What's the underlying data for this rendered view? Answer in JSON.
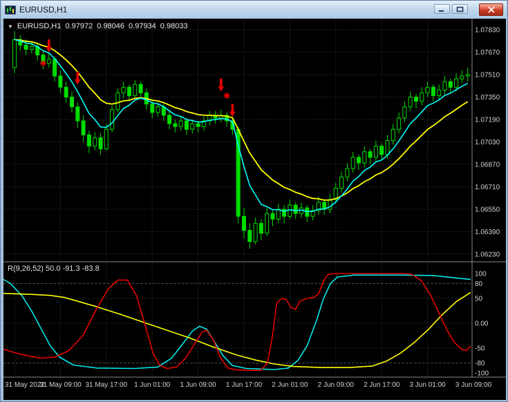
{
  "window": {
    "title": "EURUSD,H1"
  },
  "chart_data": {
    "type": "candlestick",
    "title": "EURUSD,H1",
    "info": {
      "marker": "▼",
      "symbol": "EURUSD,H1",
      "open": "0.97972",
      "high": "0.98046",
      "low": "0.97934",
      "close": "0.98033"
    },
    "price_axis": [
      "1.07830",
      "1.07670",
      "1.07510",
      "1.07350",
      "1.07190",
      "1.07030",
      "1.06870",
      "1.06710",
      "1.06550",
      "1.06390",
      "1.06230"
    ],
    "time_axis": [
      "31 May 2022",
      "31 May 09:00",
      "31 May 17:00",
      "1 Jun 01:00",
      "1 Jun 09:00",
      "1 Jun 17:00",
      "2 Jun 01:00",
      "2 Jun 09:00",
      "2 Jun 17:00",
      "3 Jun 01:00",
      "3 Jun 09:00"
    ],
    "ylim": [
      1.0618,
      1.079
    ],
    "ind_ylim": [
      -100,
      100
    ],
    "colors": {
      "background": "#000000",
      "grid": "#3a3a3a",
      "candle": "#00dd00",
      "ma_fast": "#00ffff",
      "ma_slow": "#ffff00",
      "signal": "#e60000",
      "axis_text": "#d2d2d2",
      "divider": "#8a8a8a",
      "ind_red": "#e60000",
      "ind_cyan": "#00e8e8",
      "ind_yellow": "#ffff00"
    },
    "ma_fast_period": 7,
    "ma_slow_period": 16,
    "candles": [
      [
        1.0756,
        1.0782,
        1.0752,
        1.0776
      ],
      [
        1.0776,
        1.0779,
        1.0768,
        1.0772
      ],
      [
        1.0772,
        1.0776,
        1.0765,
        1.0769
      ],
      [
        1.0769,
        1.0775,
        1.0766,
        1.0771
      ],
      [
        1.0771,
        1.0773,
        1.0761,
        1.0765
      ],
      [
        1.0765,
        1.0768,
        1.0755,
        1.0759
      ],
      [
        1.0759,
        1.0766,
        1.0756,
        1.0762
      ],
      [
        1.0762,
        1.0764,
        1.0746,
        1.075
      ],
      [
        1.075,
        1.0754,
        1.0738,
        1.0742
      ],
      [
        1.0742,
        1.0746,
        1.0731,
        1.0735
      ],
      [
        1.0735,
        1.0739,
        1.0724,
        1.0728
      ],
      [
        1.0728,
        1.0731,
        1.0713,
        1.0718
      ],
      [
        1.0718,
        1.0722,
        1.0703,
        1.0708
      ],
      [
        1.0708,
        1.0711,
        1.0695,
        1.07
      ],
      [
        1.07,
        1.071,
        1.0697,
        1.0706
      ],
      [
        1.0706,
        1.0709,
        1.0694,
        1.0698
      ],
      [
        1.0698,
        1.0716,
        1.0697,
        1.0712
      ],
      [
        1.0712,
        1.0729,
        1.071,
        1.0726
      ],
      [
        1.0726,
        1.0741,
        1.0724,
        1.0738
      ],
      [
        1.0738,
        1.0746,
        1.0734,
        1.0742
      ],
      [
        1.0742,
        1.0744,
        1.0732,
        1.0736
      ],
      [
        1.0736,
        1.0747,
        1.0734,
        1.0744
      ],
      [
        1.0744,
        1.0746,
        1.0734,
        1.0738
      ],
      [
        1.0738,
        1.0741,
        1.0726,
        1.073
      ],
      [
        1.073,
        1.0733,
        1.072,
        1.0724
      ],
      [
        1.0724,
        1.0731,
        1.0721,
        1.0728
      ],
      [
        1.0728,
        1.073,
        1.0718,
        1.0722
      ],
      [
        1.0722,
        1.0725,
        1.0712,
        1.0716
      ],
      [
        1.0716,
        1.0719,
        1.071,
        1.0714
      ],
      [
        1.0714,
        1.0721,
        1.0711,
        1.0718
      ],
      [
        1.0718,
        1.072,
        1.0708,
        1.0712
      ],
      [
        1.0712,
        1.0719,
        1.0709,
        1.0716
      ],
      [
        1.0716,
        1.0718,
        1.071,
        1.0714
      ],
      [
        1.0714,
        1.0721,
        1.0711,
        1.0718
      ],
      [
        1.0718,
        1.0725,
        1.0715,
        1.0722
      ],
      [
        1.0722,
        1.0725,
        1.0716,
        1.072
      ],
      [
        1.072,
        1.0726,
        1.0717,
        1.0722
      ],
      [
        1.0722,
        1.0724,
        1.0714,
        1.0718
      ],
      [
        1.0718,
        1.072,
        1.0708,
        1.0712
      ],
      [
        1.0712,
        1.0714,
        1.0645,
        1.065
      ],
      [
        1.065,
        1.0656,
        1.0634,
        1.064
      ],
      [
        1.064,
        1.0645,
        1.0627,
        1.0632
      ],
      [
        1.0632,
        1.0649,
        1.063,
        1.0645
      ],
      [
        1.0645,
        1.0648,
        1.0633,
        1.0638
      ],
      [
        1.0638,
        1.0656,
        1.0636,
        1.0652
      ],
      [
        1.0652,
        1.0655,
        1.0643,
        1.0648
      ],
      [
        1.0648,
        1.0659,
        1.0645,
        1.0655
      ],
      [
        1.0655,
        1.0658,
        1.0645,
        1.065
      ],
      [
        1.065,
        1.0662,
        1.0648,
        1.0658
      ],
      [
        1.0658,
        1.066,
        1.0648,
        1.0652
      ],
      [
        1.0652,
        1.066,
        1.0649,
        1.0656
      ],
      [
        1.0656,
        1.0658,
        1.0646,
        1.065
      ],
      [
        1.065,
        1.0658,
        1.0647,
        1.0654
      ],
      [
        1.0654,
        1.0664,
        1.0651,
        1.066
      ],
      [
        1.066,
        1.0662,
        1.0651,
        1.0655
      ],
      [
        1.0655,
        1.0666,
        1.0652,
        1.0662
      ],
      [
        1.0662,
        1.0674,
        1.0659,
        1.067
      ],
      [
        1.067,
        1.0682,
        1.0667,
        1.0678
      ],
      [
        1.0678,
        1.0688,
        1.0675,
        1.0684
      ],
      [
        1.0684,
        1.0696,
        1.0681,
        1.0692
      ],
      [
        1.0692,
        1.0694,
        1.0683,
        1.0688
      ],
      [
        1.0688,
        1.07,
        1.0685,
        1.0696
      ],
      [
        1.0696,
        1.0698,
        1.0687,
        1.0692
      ],
      [
        1.0692,
        1.0704,
        1.0689,
        1.07
      ],
      [
        1.07,
        1.0702,
        1.069,
        1.0694
      ],
      [
        1.0694,
        1.0708,
        1.0691,
        1.0704
      ],
      [
        1.0704,
        1.0716,
        1.0701,
        1.0712
      ],
      [
        1.0712,
        1.0724,
        1.0709,
        1.072
      ],
      [
        1.072,
        1.0732,
        1.0717,
        1.0728
      ],
      [
        1.0728,
        1.0739,
        1.0725,
        1.0735
      ],
      [
        1.0735,
        1.0737,
        1.0727,
        1.0732
      ],
      [
        1.0732,
        1.0742,
        1.0729,
        1.0738
      ],
      [
        1.0738,
        1.0746,
        1.0735,
        1.0742
      ],
      [
        1.0742,
        1.0744,
        1.0732,
        1.0736
      ],
      [
        1.0736,
        1.0744,
        1.0733,
        1.074
      ],
      [
        1.074,
        1.075,
        1.0737,
        1.0746
      ],
      [
        1.0746,
        1.0748,
        1.0738,
        1.0742
      ],
      [
        1.0742,
        1.0752,
        1.0739,
        1.0748
      ],
      [
        1.0748,
        1.0754,
        1.0745,
        1.075
      ],
      [
        1.075,
        1.0756,
        1.0746,
        1.0751
      ]
    ],
    "signals": {
      "arrows": [
        {
          "bar": 6,
          "price": 1.0767
        },
        {
          "bar": 11,
          "price": 1.0744
        },
        {
          "bar": 36,
          "price": 1.0739
        },
        {
          "bar": 38,
          "price": 1.0721
        }
      ],
      "stars": [
        {
          "bar": 5,
          "price": 1.0759
        },
        {
          "bar": 37,
          "price": 1.0736
        }
      ]
    },
    "indicator": {
      "label": "R(9,26,52) 50.0 -91.3 -83.8",
      "scale": [
        {
          "v": 100,
          "label": "100"
        },
        {
          "v": 80,
          "label": "80"
        },
        {
          "v": 50,
          "label": "50"
        },
        {
          "v": 0,
          "label": "0.00"
        },
        {
          "v": -50,
          "label": "-50"
        },
        {
          "v": -80,
          "label": "-80"
        },
        {
          "v": -100,
          "label": "-100"
        }
      ],
      "levels": [
        80,
        50,
        0,
        -50,
        -80
      ],
      "series": [
        {
          "name": "cyan",
          "color": "#00e8e8",
          "points": [
            [
              0,
              88
            ],
            [
              0.015,
              80
            ],
            [
              0.04,
              55
            ],
            [
              0.06,
              25
            ],
            [
              0.08,
              -10
            ],
            [
              0.1,
              -45
            ],
            [
              0.12,
              -68
            ],
            [
              0.15,
              -84
            ],
            [
              0.2,
              -90
            ],
            [
              0.28,
              -91
            ],
            [
              0.33,
              -88
            ],
            [
              0.36,
              -70
            ],
            [
              0.385,
              -40
            ],
            [
              0.405,
              -15
            ],
            [
              0.42,
              -6
            ],
            [
              0.435,
              -12
            ],
            [
              0.45,
              -35
            ],
            [
              0.47,
              -65
            ],
            [
              0.49,
              -85
            ],
            [
              0.52,
              -91
            ],
            [
              0.58,
              -93
            ],
            [
              0.61,
              -90
            ],
            [
              0.63,
              -75
            ],
            [
              0.65,
              -45
            ],
            [
              0.67,
              5
            ],
            [
              0.685,
              50
            ],
            [
              0.7,
              80
            ],
            [
              0.715,
              93
            ],
            [
              0.75,
              97
            ],
            [
              0.85,
              97
            ],
            [
              0.92,
              96
            ],
            [
              0.96,
              92
            ],
            [
              1.0,
              88
            ]
          ]
        },
        {
          "name": "yellow",
          "color": "#ffff00",
          "points": [
            [
              0,
              60
            ],
            [
              0.06,
              58
            ],
            [
              0.1,
              56
            ],
            [
              0.13,
              52
            ],
            [
              0.16,
              44
            ],
            [
              0.2,
              33
            ],
            [
              0.25,
              18
            ],
            [
              0.3,
              2
            ],
            [
              0.35,
              -14
            ],
            [
              0.4,
              -30
            ],
            [
              0.45,
              -48
            ],
            [
              0.5,
              -64
            ],
            [
              0.54,
              -74
            ],
            [
              0.58,
              -82
            ],
            [
              0.62,
              -87
            ],
            [
              0.68,
              -89
            ],
            [
              0.74,
              -89
            ],
            [
              0.79,
              -86
            ],
            [
              0.82,
              -76
            ],
            [
              0.85,
              -60
            ],
            [
              0.88,
              -38
            ],
            [
              0.91,
              -12
            ],
            [
              0.94,
              18
            ],
            [
              0.97,
              44
            ],
            [
              1.0,
              62
            ]
          ]
        },
        {
          "name": "red",
          "color": "#e60000",
          "points": [
            [
              0,
              -52
            ],
            [
              0.02,
              -58
            ],
            [
              0.05,
              -65
            ],
            [
              0.08,
              -70
            ],
            [
              0.11,
              -68
            ],
            [
              0.14,
              -55
            ],
            [
              0.17,
              -25
            ],
            [
              0.2,
              30
            ],
            [
              0.225,
              70
            ],
            [
              0.245,
              87
            ],
            [
              0.265,
              87
            ],
            [
              0.285,
              55
            ],
            [
              0.305,
              -10
            ],
            [
              0.32,
              -60
            ],
            [
              0.335,
              -85
            ],
            [
              0.35,
              -91
            ],
            [
              0.37,
              -88
            ],
            [
              0.39,
              -70
            ],
            [
              0.41,
              -40
            ],
            [
              0.425,
              -18
            ],
            [
              0.435,
              -14
            ],
            [
              0.45,
              -35
            ],
            [
              0.465,
              -70
            ],
            [
              0.48,
              -90
            ],
            [
              0.5,
              -94
            ],
            [
              0.55,
              -95
            ],
            [
              0.565,
              -80
            ],
            [
              0.575,
              -30
            ],
            [
              0.585,
              40
            ],
            [
              0.595,
              50
            ],
            [
              0.605,
              48
            ],
            [
              0.615,
              32
            ],
            [
              0.625,
              28
            ],
            [
              0.635,
              45
            ],
            [
              0.65,
              50
            ],
            [
              0.665,
              52
            ],
            [
              0.675,
              60
            ],
            [
              0.685,
              85
            ],
            [
              0.695,
              98
            ],
            [
              0.71,
              100
            ],
            [
              0.8,
              100
            ],
            [
              0.855,
              100
            ],
            [
              0.875,
              98
            ],
            [
              0.895,
              85
            ],
            [
              0.915,
              55
            ],
            [
              0.935,
              15
            ],
            [
              0.95,
              -15
            ],
            [
              0.965,
              -38
            ],
            [
              0.98,
              -52
            ],
            [
              0.99,
              -55
            ],
            [
              1.0,
              -46
            ]
          ]
        }
      ]
    }
  }
}
